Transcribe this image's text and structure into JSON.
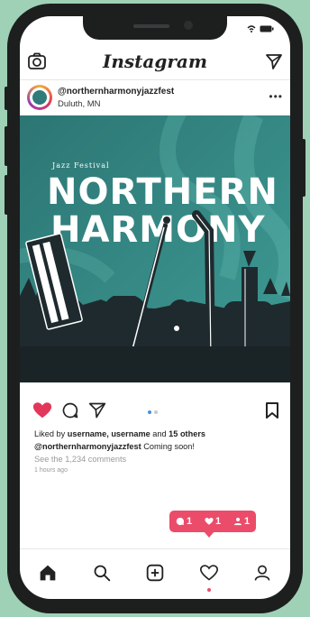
{
  "app": {
    "brand": "Instagram"
  },
  "post": {
    "username": "@northernharmonyjazzfest",
    "location": "Duluth, MN",
    "more": "•••",
    "artwork": {
      "subtitle": "Jazz Festival",
      "title_line1": "NORTHERN",
      "title_line2": "HARMONY"
    },
    "likes": {
      "prefix": "Liked by ",
      "user1": "username,",
      "user2": "username",
      "middle": " and ",
      "others": "15 others"
    },
    "caption": {
      "user": "@northernharmonyjazzfest",
      "text": " Coming soon!"
    },
    "comments_link": "See the 1,234 comments",
    "timestamp": "1 hours ago"
  },
  "notifications": {
    "comments": "1",
    "likes": "1",
    "followers": "1"
  },
  "colors": {
    "accent": "#ea4c6a",
    "artwork_bg": "#2f7c7a",
    "artwork_dark": "#1f2a2e"
  },
  "icons": {
    "topbar": [
      "camera-icon",
      "send-icon"
    ],
    "actions": [
      "heart-icon",
      "comment-icon",
      "share-icon",
      "bookmark-icon"
    ],
    "nav": [
      "home-icon",
      "search-icon",
      "add-icon",
      "activity-icon",
      "profile-icon"
    ]
  }
}
